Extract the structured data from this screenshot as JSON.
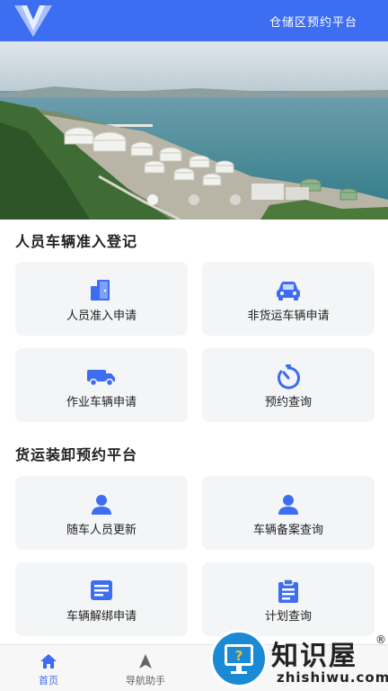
{
  "header": {
    "title": "仓储区预约平台"
  },
  "banner": {
    "dots": 3,
    "active_dot": 0
  },
  "section1": {
    "title": "人员车辆准入登记",
    "cards": [
      {
        "label": "人员准入申请",
        "icon": "door-icon"
      },
      {
        "label": "非货运车辆申请",
        "icon": "car-icon"
      },
      {
        "label": "作业车辆申请",
        "icon": "truck-icon"
      },
      {
        "label": "预约查询",
        "icon": "stopwatch-icon"
      }
    ]
  },
  "section2": {
    "title": "货运装卸预约平台",
    "cards": [
      {
        "label": "随车人员更新",
        "icon": "person-icon"
      },
      {
        "label": "车辆备案查询",
        "icon": "person-icon"
      },
      {
        "label": "车辆解绑申请",
        "icon": "document-icon"
      },
      {
        "label": "计划查询",
        "icon": "clipboard-icon"
      }
    ]
  },
  "tabbar": {
    "tabs": [
      {
        "label": "首页",
        "icon": "home-icon",
        "active": true
      },
      {
        "label": "导航助手",
        "icon": "navigation-arrow-icon",
        "active": false
      },
      {
        "label": "",
        "icon": "",
        "active": false
      },
      {
        "label": "",
        "icon": "",
        "active": false
      }
    ]
  },
  "watermark": {
    "text": "知识屋",
    "reg": "®",
    "url": "zhishiwu.com"
  },
  "colors": {
    "accent": "#3d6df0",
    "card_bg": "#f4f5f7"
  }
}
